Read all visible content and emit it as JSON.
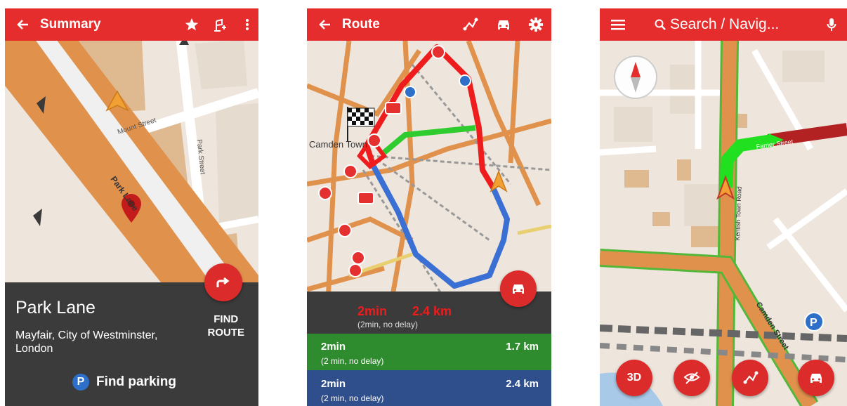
{
  "summary": {
    "title": "Summary",
    "icons": [
      "back-arrow-icon",
      "star-icon",
      "add-route-flag-icon",
      "more-vertical-icon"
    ],
    "map_labels": {
      "street1": "Mount Street",
      "street2": "Park Street",
      "road": "Park Lane"
    },
    "place_title": "Park Lane",
    "place_address": "Mayfair, City of Westminster, London",
    "find_route_label_1": "FIND",
    "find_route_label_2": "ROUTE",
    "find_parking_label": "Find parking",
    "parking_symbol": "P"
  },
  "route": {
    "title": "Route",
    "icons": [
      "back-arrow-icon",
      "route-icon",
      "car-icon",
      "settings-icon"
    ],
    "map_labels": {
      "area": "Camden Town"
    },
    "selected": {
      "time": "2min",
      "distance": "2.4 km",
      "sub": "(2min, no delay)"
    },
    "alternatives": [
      {
        "time": "2min",
        "distance": "1.7 km",
        "sub": "(2 min, no delay)",
        "color": "#2e8b2e"
      },
      {
        "time": "2min",
        "distance": "2.4 km",
        "sub": "(2 min, no delay)",
        "color": "#2f4e8c"
      }
    ]
  },
  "navigate": {
    "search_placeholder": "Search / Navig...",
    "icons": [
      "menu-icon",
      "search-icon",
      "microphone-icon",
      "compass-icon"
    ],
    "map_labels": {
      "street1": "Farrier Street",
      "street2": "Kentish Town Road",
      "street3": "Camden Street"
    },
    "parking_symbol": "P",
    "buttons": {
      "three_d": "3D"
    }
  },
  "colors": {
    "accent": "#e52d2d",
    "road_orange": "#e0924d",
    "sheet_dark": "#3b3b3b",
    "route_red": "#ee1c1c",
    "route_green": "#2ecc2e",
    "route_blue": "#3a6fd4"
  }
}
